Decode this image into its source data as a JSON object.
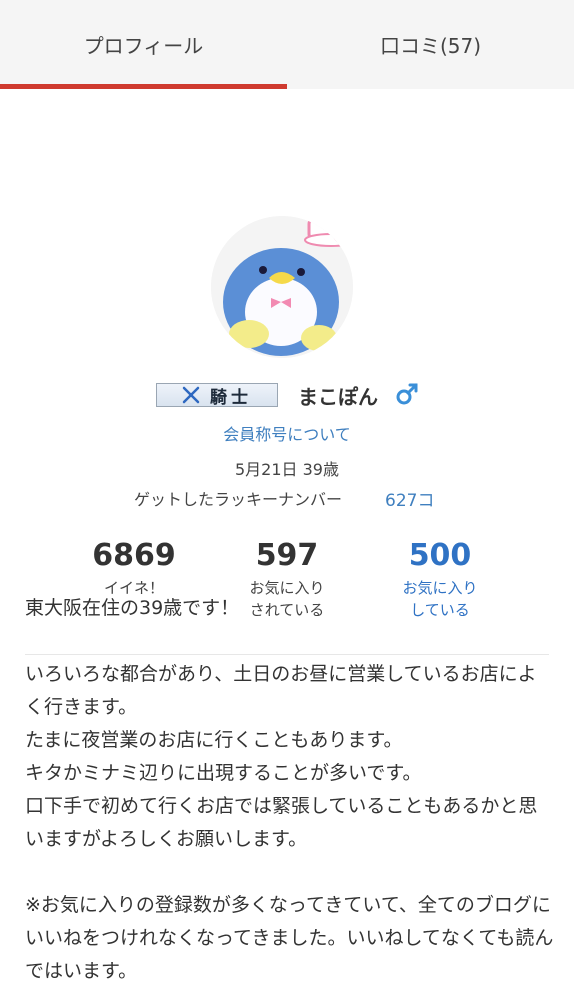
{
  "tabs": [
    {
      "label": "プロフィール",
      "active": true
    },
    {
      "label": "口コミ(57)",
      "active": false
    }
  ],
  "colors": {
    "accent": "#cf3a2f",
    "link": "#3f7fbf",
    "stat_blue": "#2f72c4"
  },
  "profile": {
    "rank_badge": "騎士",
    "rank_icon": "crossed-swords-icon",
    "username": "まこぽん",
    "gender_icon": "male-icon",
    "title_link": "会員称号について",
    "birthday": "5月21日 39歳",
    "lucky_label": "ゲットしたラッキーナンバー",
    "lucky_value": "627コ"
  },
  "stats": [
    {
      "value": "6869",
      "label": "イイネ！"
    },
    {
      "value": "597",
      "label": "お気に入り\nされている"
    },
    {
      "value": "500",
      "label": "お気に入り\nしている"
    }
  ],
  "bio": "東大阪在住の39歳です！\n\nいろいろな都合があり、土日のお昼に営業しているお店によく行きます。\nたまに夜営業のお店に行くこともあります。\nキタかミナミ辺りに出現することが多いです。\n口下手で初めて行くお店では緊張していることもあるかと思いますがよろしくお願いします。\n\n※お気に入りの登録数が多くなってきていて、全てのブログにいいねをつけれなくなってきました。いいねしてなくても読んではいます。"
}
